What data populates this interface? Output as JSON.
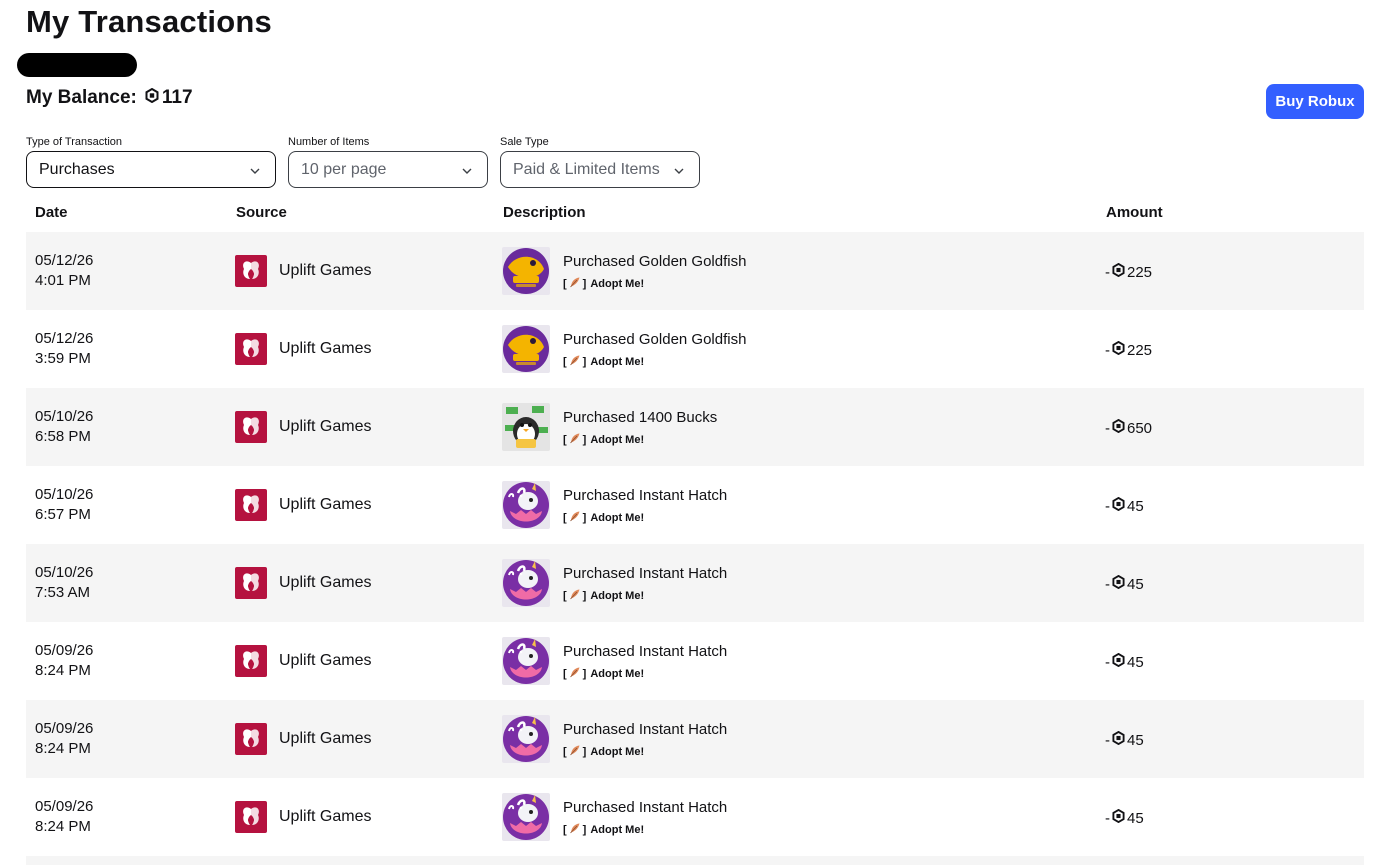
{
  "page": {
    "title": "My Transactions",
    "balance_label": "My Balance:",
    "balance_value": "117",
    "buy_robux_label": "Buy Robux"
  },
  "filters": [
    {
      "label": "Type of Transaction",
      "value": "Purchases"
    },
    {
      "label": "Number of Items",
      "value": "10 per page"
    },
    {
      "label": "Sale Type",
      "value": "Paid & Limited Items"
    }
  ],
  "table": {
    "headers": [
      "Date",
      "Source",
      "Description",
      "Amount"
    ],
    "rows": [
      {
        "date": "05/12/26",
        "time": "4:01 PM",
        "source": "Uplift Games",
        "thumb": "goldfish",
        "description": "Purchased Golden Goldfish",
        "place_open": "[",
        "place_close": "]",
        "place": "Adopt Me!",
        "sign": "-",
        "amount": "225"
      },
      {
        "date": "05/12/26",
        "time": "3:59 PM",
        "source": "Uplift Games",
        "thumb": "goldfish",
        "description": "Purchased Golden Goldfish",
        "place_open": "[",
        "place_close": "]",
        "place": "Adopt Me!",
        "sign": "-",
        "amount": "225"
      },
      {
        "date": "05/10/26",
        "time": "6:58 PM",
        "source": "Uplift Games",
        "thumb": "bucks",
        "description": "Purchased 1400 Bucks",
        "place_open": "[",
        "place_close": "]",
        "place": "Adopt Me!",
        "sign": "-",
        "amount": "650"
      },
      {
        "date": "05/10/26",
        "time": "6:57 PM",
        "source": "Uplift Games",
        "thumb": "hatch",
        "description": "Purchased Instant Hatch",
        "place_open": "[",
        "place_close": "]",
        "place": "Adopt Me!",
        "sign": "-",
        "amount": "45"
      },
      {
        "date": "05/10/26",
        "time": "7:53 AM",
        "source": "Uplift Games",
        "thumb": "hatch",
        "description": "Purchased Instant Hatch",
        "place_open": "[",
        "place_close": "]",
        "place": "Adopt Me!",
        "sign": "-",
        "amount": "45"
      },
      {
        "date": "05/09/26",
        "time": "8:24 PM",
        "source": "Uplift Games",
        "thumb": "hatch",
        "description": "Purchased Instant Hatch",
        "place_open": "[",
        "place_close": "]",
        "place": "Adopt Me!",
        "sign": "-",
        "amount": "45"
      },
      {
        "date": "05/09/26",
        "time": "8:24 PM",
        "source": "Uplift Games",
        "thumb": "hatch",
        "description": "Purchased Instant Hatch",
        "place_open": "[",
        "place_close": "]",
        "place": "Adopt Me!",
        "sign": "-",
        "amount": "45"
      },
      {
        "date": "05/09/26",
        "time": "8:24 PM",
        "source": "Uplift Games",
        "thumb": "hatch",
        "description": "Purchased Instant Hatch",
        "place_open": "[",
        "place_close": "]",
        "place": "Adopt Me!",
        "sign": "-",
        "amount": "45"
      }
    ]
  },
  "colors": {
    "accent": "#335fff",
    "row_shade": "#f5f5f5",
    "source_logo": "#b5123f"
  },
  "icons": {
    "currency": "robux-icon",
    "dropdown": "chevron-down-icon",
    "source": "uplift-games-logo",
    "place": "feather-icon"
  }
}
